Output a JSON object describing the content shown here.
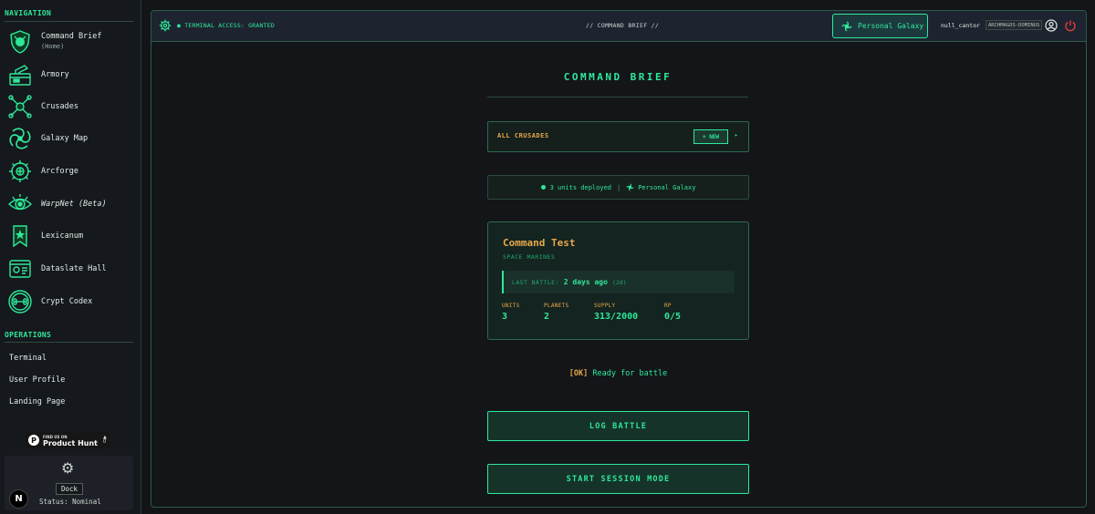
{
  "colors": {
    "accent": "#2ee89a",
    "warning": "#e8a84a",
    "danger": "#e23b3b",
    "background": "#121418"
  },
  "sidebar": {
    "navigation_title": "NAVIGATION",
    "items": [
      {
        "label": "Command Brief",
        "sub": "(Home)",
        "icon": "shield-crest-icon"
      },
      {
        "label": "Armory",
        "icon": "armory-crate-icon"
      },
      {
        "label": "Crusades",
        "icon": "crossed-swords-icon"
      },
      {
        "label": "Galaxy Map",
        "icon": "spiral-galaxy-icon"
      },
      {
        "label": "Arcforge",
        "icon": "cog-forge-icon"
      },
      {
        "label": "WarpNet (Beta)",
        "icon": "warp-eye-icon"
      },
      {
        "label": "Lexicanum",
        "icon": "banner-book-icon"
      },
      {
        "label": "Dataslate Hall",
        "icon": "dataslate-icon"
      },
      {
        "label": "Crypt Codex",
        "icon": "crypt-bone-icon"
      }
    ],
    "operations_title": "OPERATIONS",
    "operations": [
      "Terminal",
      "User Profile",
      "Landing Page"
    ],
    "product_hunt": {
      "small": "FIND US ON",
      "big": "Product Hunt",
      "logo": "P"
    },
    "dock": {
      "icon": "gear-icon",
      "button": "Dock",
      "status": "Status: Nominal"
    },
    "badge_letter": "N"
  },
  "topbar": {
    "access": "● TERMINAL ACCESS: GRANTED",
    "center": "// COMMAND BRIEF //",
    "galaxy_button": "Personal Galaxy",
    "username": "null_cantor",
    "role": "ARCHMAGOS-DOMINUS"
  },
  "main": {
    "title": "COMMAND BRIEF",
    "crusades_label": "ALL CRUSADES",
    "new_button": "+ NEW",
    "arrow": "▸",
    "status": {
      "units": "3 units deployed",
      "separator": "|",
      "galaxy": "Personal Galaxy"
    },
    "card": {
      "title": "Command Test",
      "faction": "SPACE MARINES",
      "last_battle_label": "LAST BATTLE:",
      "last_battle_value": "2 days ago",
      "last_battle_short": "(2d)",
      "stats": [
        {
          "label": "UNITS",
          "value": "3"
        },
        {
          "label": "PLANETS",
          "value": "2"
        },
        {
          "label": "SUPPLY",
          "value": "313/2000"
        },
        {
          "label": "RP",
          "value": "0/5"
        }
      ]
    },
    "ready": {
      "ok": "[OK]",
      "text": "Ready for battle"
    },
    "log_battle": "LOG BATTLE",
    "session_mode": "START SESSION MODE"
  }
}
